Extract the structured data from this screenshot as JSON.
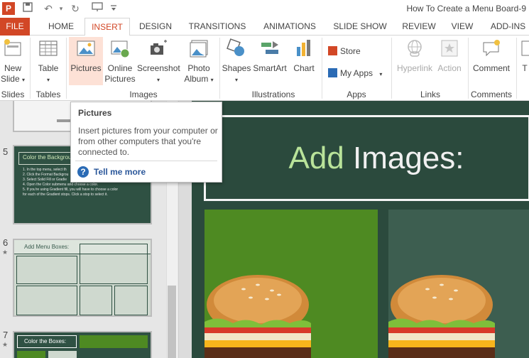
{
  "titlebar": {
    "app_logo": "P",
    "title": "How To Create a Menu Board-9"
  },
  "tabs": [
    {
      "label": "FILE"
    },
    {
      "label": "HOME"
    },
    {
      "label": "INSERT"
    },
    {
      "label": "DESIGN"
    },
    {
      "label": "TRANSITIONS"
    },
    {
      "label": "ANIMATIONS"
    },
    {
      "label": "SLIDE SHOW"
    },
    {
      "label": "REVIEW"
    },
    {
      "label": "VIEW"
    },
    {
      "label": "ADD-INS"
    }
  ],
  "ribbon": {
    "new_slide": {
      "line1": "New",
      "line2": "Slide"
    },
    "table": "Table",
    "pictures": "Pictures",
    "online_pictures": {
      "line1": "Online",
      "line2": "Pictures"
    },
    "screenshot": "Screenshot",
    "photo_album": {
      "line1": "Photo",
      "line2": "Album"
    },
    "shapes": "Shapes",
    "smartart": "SmartArt",
    "chart": "Chart",
    "store": "Store",
    "my_apps": "My Apps",
    "hyperlink": "Hyperlink",
    "action": "Action",
    "comment": "Comment",
    "partial_t": "T",
    "groups": {
      "slides": "Slides",
      "tables": "Tables",
      "images": "Images",
      "illustrations": "Illustrations",
      "apps": "Apps",
      "links": "Links",
      "comments": "Comments"
    }
  },
  "tooltip": {
    "title": "Pictures",
    "body": "Insert pictures from your computer or from other computers that you're connected to.",
    "link": "Tell me more",
    "help_glyph": "?"
  },
  "slides": [
    {
      "number": "5",
      "title": "Color the Backgrou",
      "lines": [
        "1. In the top menu, select th",
        "2. Click the Format Backgrou",
        "3. Select Solid Fill or Gradie",
        "4. Open the Color submenu and choose a color.",
        "5. If you're using Gradient fill, you will have to choose a color",
        "for each of the Gradient stops. Click a stop to select it."
      ]
    },
    {
      "number": "6",
      "star": "★",
      "title": "Add Menu Boxes:"
    },
    {
      "number": "7",
      "star": "★",
      "title": "Color the Boxes:"
    }
  ],
  "main_slide": {
    "title_accent": "Add",
    "title_rest": " Images:"
  },
  "colors": {
    "accent": "#d24726",
    "slide_bg": "#2b4a3d",
    "title_accent": "#b9e39a"
  }
}
